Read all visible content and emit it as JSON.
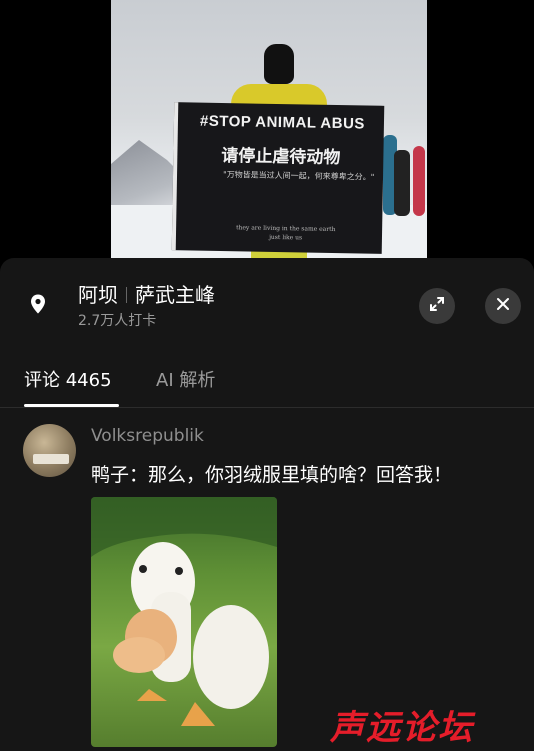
{
  "photo": {
    "banner_title": "#STOP ANIMAL ABUS",
    "banner_chinese": "请停止虐待动物",
    "banner_small": "\"万物皆是当过人间一起，何来尊卑之分。\"",
    "banner_footer_1": "they are living in the same earth",
    "banner_footer_2": "just like us"
  },
  "location": {
    "name_part1": "阿坝",
    "name_part2": "萨武主峰",
    "checkins": "2.7万人打卡"
  },
  "tabs": [
    {
      "label": "评论 4465",
      "active": true
    },
    {
      "label": "AI 解析",
      "active": false
    }
  ],
  "comment": {
    "username": "Volksrepublik",
    "text": "鸭子：那么，你羽绒服里填的啥？回答我！"
  },
  "watermark": "声远论坛",
  "icons": {
    "location": "map-pin-icon",
    "expand": "expand-icon",
    "close": "close-icon"
  },
  "colors": {
    "panel_bg": "#161616",
    "watermark": "#e51d2a",
    "secondary_text": "#9a9a9a"
  }
}
